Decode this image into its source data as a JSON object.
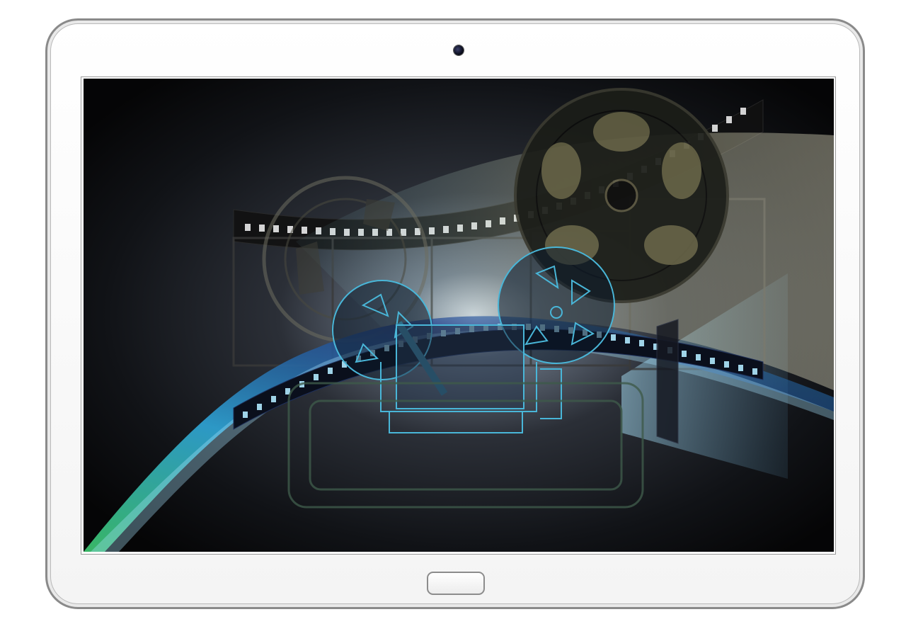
{
  "device": {
    "type": "tablet",
    "frame_color": "#8a8a8a",
    "bezel_color": "#ffffff"
  },
  "screen": {
    "artwork": "cinema-film-reel-illustration",
    "background_color": "#0c0d10",
    "accent_colors": [
      "#2fa6d8",
      "#3bbf6a",
      "#d9d7b0",
      "#1d3b8c"
    ]
  },
  "icons": {
    "camera": "front-camera-icon",
    "home": "home-button",
    "reel_large": "film-reel-icon",
    "projector": "film-projector-icon",
    "film_strip": "film-strip-icon"
  }
}
